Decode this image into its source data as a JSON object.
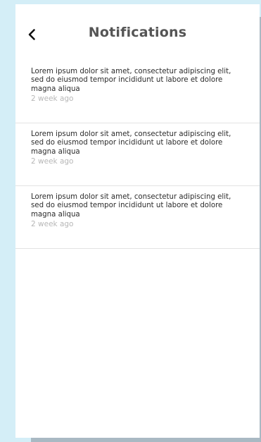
{
  "header": {
    "title": "Notifications",
    "back_icon": "chevron-left-icon"
  },
  "notifications": [
    {
      "text": "Lorem ipsum dolor sit amet, consectetur adipiscing elit, sed do eiusmod tempor incididunt ut labore et dolore magna aliqua",
      "time": "2 week ago"
    },
    {
      "text": "Lorem ipsum dolor sit amet, consectetur adipiscing elit, sed do eiusmod tempor incididunt ut labore et dolore magna aliqua",
      "time": "2 week ago"
    },
    {
      "text": "Lorem ipsum dolor sit amet, consectetur adipiscing elit, sed do eiusmod tempor incididunt ut labore et dolore magna aliqua",
      "time": "2 week ago"
    }
  ],
  "colors": {
    "background": "#d4eef7",
    "card": "#ffffff",
    "title": "#555555",
    "body_text": "#2b2b2b",
    "time_text": "#b7b7b7",
    "divider": "#e3e3e3"
  }
}
